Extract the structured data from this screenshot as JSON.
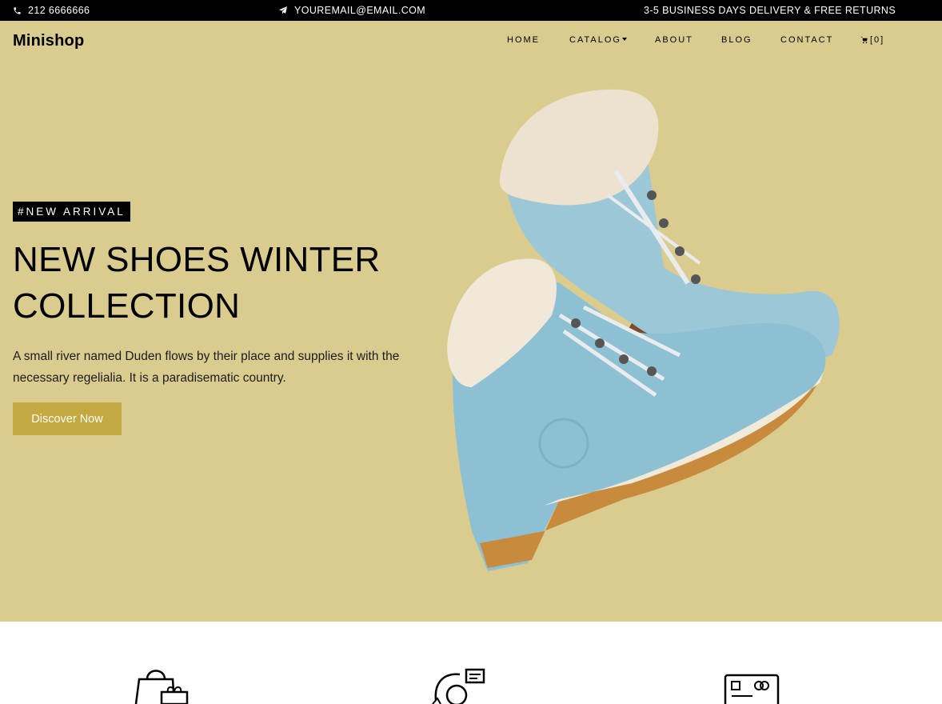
{
  "topbar": {
    "phone": "212 6666666",
    "email": "YOUREMAIL@EMAIL.COM",
    "delivery": "3-5 BUSINESS DAYS DELIVERY & FREE RETURNS",
    "icons": [
      "phone-icon",
      "paper-plane-icon"
    ]
  },
  "header": {
    "brand": "Minishop",
    "nav": [
      {
        "label": "HOME"
      },
      {
        "label": "CATALOG"
      },
      {
        "label": "ABOUT"
      },
      {
        "label": "BLOG"
      },
      {
        "label": "CONTACT"
      }
    ],
    "cart_count": "[0]"
  },
  "hero": {
    "badge": "#NEW ARRIVAL",
    "title_line1": "NEW SHOES WINTER",
    "title_line2": "COLLECTION",
    "description": "A small river named Duden flows by their place and supplies it with the necessary regelialia. It is a paradisematic country.",
    "cta_label": "Discover Now",
    "image": "blue-winter-boots"
  },
  "features": {
    "icons": [
      "shopping-bag-gift-icon",
      "customer-support-icon",
      "payment-card-icon"
    ]
  },
  "colors": {
    "topbar_bg": "#000000",
    "hero_bg": "#dacc8f",
    "accent": "#c3a940"
  }
}
